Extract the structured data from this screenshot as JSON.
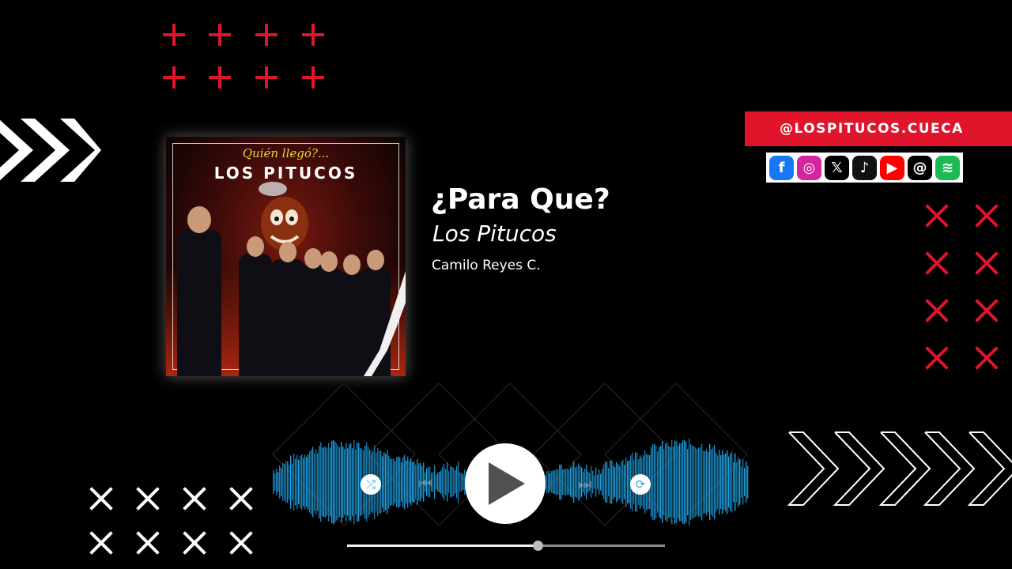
{
  "song": {
    "title": "¿Para Que?",
    "artist": "Los Pitucos",
    "credit": "Camilo Reyes C."
  },
  "album_art": {
    "subtitle": "Quién llegó?...",
    "title": "LOS PITUCOS"
  },
  "social": {
    "handle": "@LOSPITUCOS.CUECA",
    "icons": [
      {
        "name": "facebook-icon",
        "glyph": "f",
        "color": "#1877f2"
      },
      {
        "name": "instagram-icon",
        "glyph": "◎",
        "color": "#d6249f"
      },
      {
        "name": "x-icon",
        "glyph": "𝕏",
        "color": "#000000"
      },
      {
        "name": "tiktok-icon",
        "glyph": "♪",
        "color": "#111111"
      },
      {
        "name": "youtube-icon",
        "glyph": "▶",
        "color": "#ff0000"
      },
      {
        "name": "threads-icon",
        "glyph": "@",
        "color": "#000000"
      },
      {
        "name": "spotify-icon",
        "glyph": "≋",
        "color": "#1db954"
      }
    ]
  },
  "player": {
    "progress": 0.6,
    "play_icon": "play-icon",
    "shuffle_icon": "shuffle-icon",
    "repeat_icon": "repeat-icon",
    "prev_icon": "skip-previous-icon",
    "next_icon": "skip-next-icon"
  },
  "colors": {
    "accent": "#e0142b",
    "wave": "#1fa6e8",
    "background": "#000000"
  }
}
